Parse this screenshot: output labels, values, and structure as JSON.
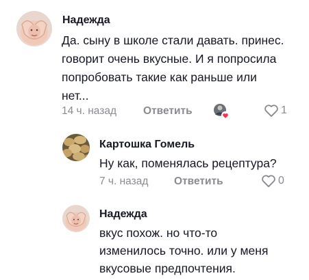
{
  "comments": [
    {
      "author": "Надежда",
      "text_lines": [
        "Да. сыну в школе стали давать. принес.",
        "говорит очень вкусные. И я попросила",
        "попробовать такие как раньше или",
        "нет..."
      ],
      "time": "14 ч. назад",
      "reply_label": "Ответить",
      "likes": "1",
      "creator_liked": true,
      "avatar_icon": "avatar-heart-hands-icon"
    },
    {
      "author": "Картошка Гомель",
      "text_lines": [
        "Ну как, поменялась рецептура?"
      ],
      "time": "7 ч. назад",
      "reply_label": "Ответить",
      "likes": "0",
      "avatar_icon": "avatar-potatoes-icon"
    },
    {
      "author": "Надежда",
      "text_lines": [
        "вкус похож. но что-то",
        "изменилось точно. или у меня",
        "вкусовые предпочтения."
      ],
      "avatar_icon": "avatar-heart-hands-icon"
    }
  ],
  "colors": {
    "text": "#161823",
    "meta": "#8a8b91",
    "creator_heart": "#fe2c55"
  }
}
